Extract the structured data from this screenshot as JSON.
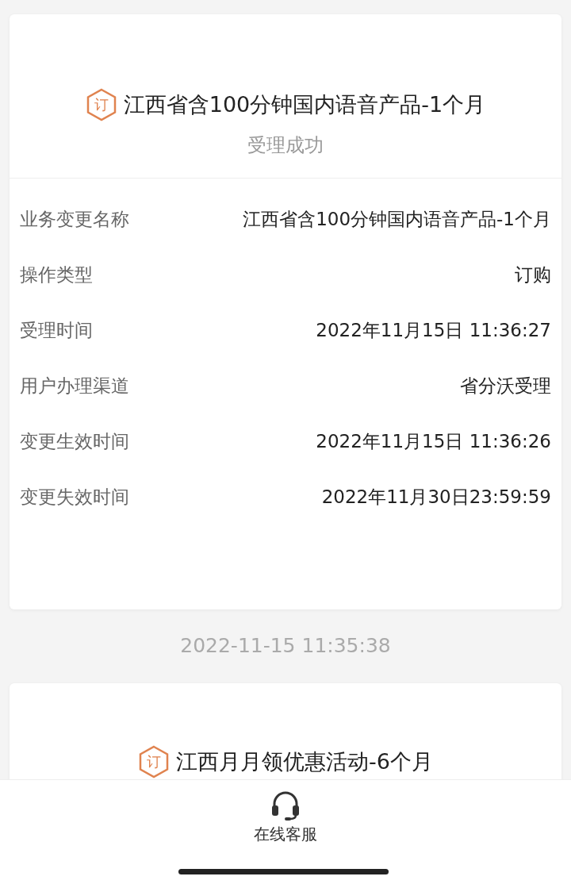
{
  "orders": [
    {
      "icon_glyph": "订",
      "title": "江西省含100分钟国内语音产品-1个月",
      "status": "受理成功",
      "details": [
        {
          "label": "业务变更名称",
          "value": "江西省含100分钟国内语音产品-1个月"
        },
        {
          "label": "操作类型",
          "value": "订购"
        },
        {
          "label": "受理时间",
          "value": "2022年11月15日 11:36:27"
        },
        {
          "label": "用户办理渠道",
          "value": "省分沃受理"
        },
        {
          "label": "变更生效时间",
          "value": "2022年11月15日 11:36:26"
        },
        {
          "label": "变更失效时间",
          "value": "2022年11月30日23:59:59"
        }
      ]
    },
    {
      "timestamp": "2022-11-15 11:35:38",
      "icon_glyph": "订",
      "title": "江西月月领优惠活动-6个月"
    }
  ],
  "bottom_bar": {
    "label": "在线客服"
  }
}
